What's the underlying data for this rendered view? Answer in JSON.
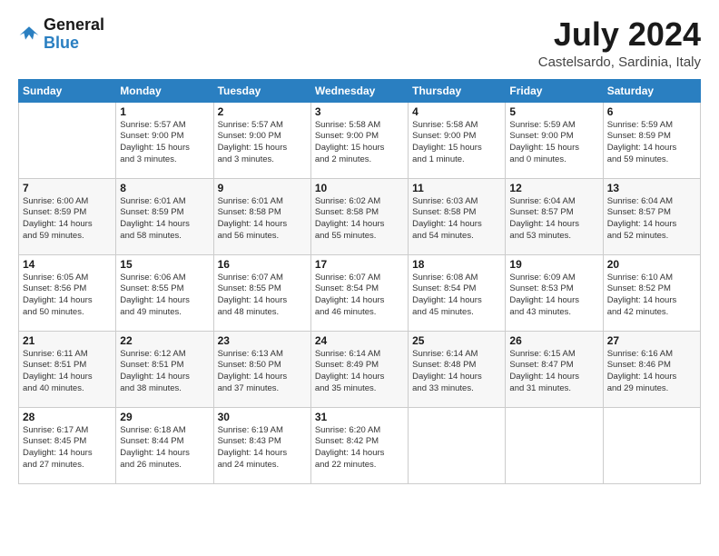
{
  "header": {
    "logo": {
      "line1": "General",
      "line2": "Blue"
    },
    "title": "July 2024",
    "location": "Castelsardo, Sardinia, Italy"
  },
  "columns": [
    "Sunday",
    "Monday",
    "Tuesday",
    "Wednesday",
    "Thursday",
    "Friday",
    "Saturday"
  ],
  "weeks": [
    {
      "cells": [
        {
          "day": "",
          "info": ""
        },
        {
          "day": "1",
          "info": "Sunrise: 5:57 AM\nSunset: 9:00 PM\nDaylight: 15 hours\nand 3 minutes."
        },
        {
          "day": "2",
          "info": "Sunrise: 5:57 AM\nSunset: 9:00 PM\nDaylight: 15 hours\nand 3 minutes."
        },
        {
          "day": "3",
          "info": "Sunrise: 5:58 AM\nSunset: 9:00 PM\nDaylight: 15 hours\nand 2 minutes."
        },
        {
          "day": "4",
          "info": "Sunrise: 5:58 AM\nSunset: 9:00 PM\nDaylight: 15 hours\nand 1 minute."
        },
        {
          "day": "5",
          "info": "Sunrise: 5:59 AM\nSunset: 9:00 PM\nDaylight: 15 hours\nand 0 minutes."
        },
        {
          "day": "6",
          "info": "Sunrise: 5:59 AM\nSunset: 8:59 PM\nDaylight: 14 hours\nand 59 minutes."
        }
      ]
    },
    {
      "cells": [
        {
          "day": "7",
          "info": "Sunrise: 6:00 AM\nSunset: 8:59 PM\nDaylight: 14 hours\nand 59 minutes."
        },
        {
          "day": "8",
          "info": "Sunrise: 6:01 AM\nSunset: 8:59 PM\nDaylight: 14 hours\nand 58 minutes."
        },
        {
          "day": "9",
          "info": "Sunrise: 6:01 AM\nSunset: 8:58 PM\nDaylight: 14 hours\nand 56 minutes."
        },
        {
          "day": "10",
          "info": "Sunrise: 6:02 AM\nSunset: 8:58 PM\nDaylight: 14 hours\nand 55 minutes."
        },
        {
          "day": "11",
          "info": "Sunrise: 6:03 AM\nSunset: 8:58 PM\nDaylight: 14 hours\nand 54 minutes."
        },
        {
          "day": "12",
          "info": "Sunrise: 6:04 AM\nSunset: 8:57 PM\nDaylight: 14 hours\nand 53 minutes."
        },
        {
          "day": "13",
          "info": "Sunrise: 6:04 AM\nSunset: 8:57 PM\nDaylight: 14 hours\nand 52 minutes."
        }
      ]
    },
    {
      "cells": [
        {
          "day": "14",
          "info": "Sunrise: 6:05 AM\nSunset: 8:56 PM\nDaylight: 14 hours\nand 50 minutes."
        },
        {
          "day": "15",
          "info": "Sunrise: 6:06 AM\nSunset: 8:55 PM\nDaylight: 14 hours\nand 49 minutes."
        },
        {
          "day": "16",
          "info": "Sunrise: 6:07 AM\nSunset: 8:55 PM\nDaylight: 14 hours\nand 48 minutes."
        },
        {
          "day": "17",
          "info": "Sunrise: 6:07 AM\nSunset: 8:54 PM\nDaylight: 14 hours\nand 46 minutes."
        },
        {
          "day": "18",
          "info": "Sunrise: 6:08 AM\nSunset: 8:54 PM\nDaylight: 14 hours\nand 45 minutes."
        },
        {
          "day": "19",
          "info": "Sunrise: 6:09 AM\nSunset: 8:53 PM\nDaylight: 14 hours\nand 43 minutes."
        },
        {
          "day": "20",
          "info": "Sunrise: 6:10 AM\nSunset: 8:52 PM\nDaylight: 14 hours\nand 42 minutes."
        }
      ]
    },
    {
      "cells": [
        {
          "day": "21",
          "info": "Sunrise: 6:11 AM\nSunset: 8:51 PM\nDaylight: 14 hours\nand 40 minutes."
        },
        {
          "day": "22",
          "info": "Sunrise: 6:12 AM\nSunset: 8:51 PM\nDaylight: 14 hours\nand 38 minutes."
        },
        {
          "day": "23",
          "info": "Sunrise: 6:13 AM\nSunset: 8:50 PM\nDaylight: 14 hours\nand 37 minutes."
        },
        {
          "day": "24",
          "info": "Sunrise: 6:14 AM\nSunset: 8:49 PM\nDaylight: 14 hours\nand 35 minutes."
        },
        {
          "day": "25",
          "info": "Sunrise: 6:14 AM\nSunset: 8:48 PM\nDaylight: 14 hours\nand 33 minutes."
        },
        {
          "day": "26",
          "info": "Sunrise: 6:15 AM\nSunset: 8:47 PM\nDaylight: 14 hours\nand 31 minutes."
        },
        {
          "day": "27",
          "info": "Sunrise: 6:16 AM\nSunset: 8:46 PM\nDaylight: 14 hours\nand 29 minutes."
        }
      ]
    },
    {
      "cells": [
        {
          "day": "28",
          "info": "Sunrise: 6:17 AM\nSunset: 8:45 PM\nDaylight: 14 hours\nand 27 minutes."
        },
        {
          "day": "29",
          "info": "Sunrise: 6:18 AM\nSunset: 8:44 PM\nDaylight: 14 hours\nand 26 minutes."
        },
        {
          "day": "30",
          "info": "Sunrise: 6:19 AM\nSunset: 8:43 PM\nDaylight: 14 hours\nand 24 minutes."
        },
        {
          "day": "31",
          "info": "Sunrise: 6:20 AM\nSunset: 8:42 PM\nDaylight: 14 hours\nand 22 minutes."
        },
        {
          "day": "",
          "info": ""
        },
        {
          "day": "",
          "info": ""
        },
        {
          "day": "",
          "info": ""
        }
      ]
    }
  ]
}
